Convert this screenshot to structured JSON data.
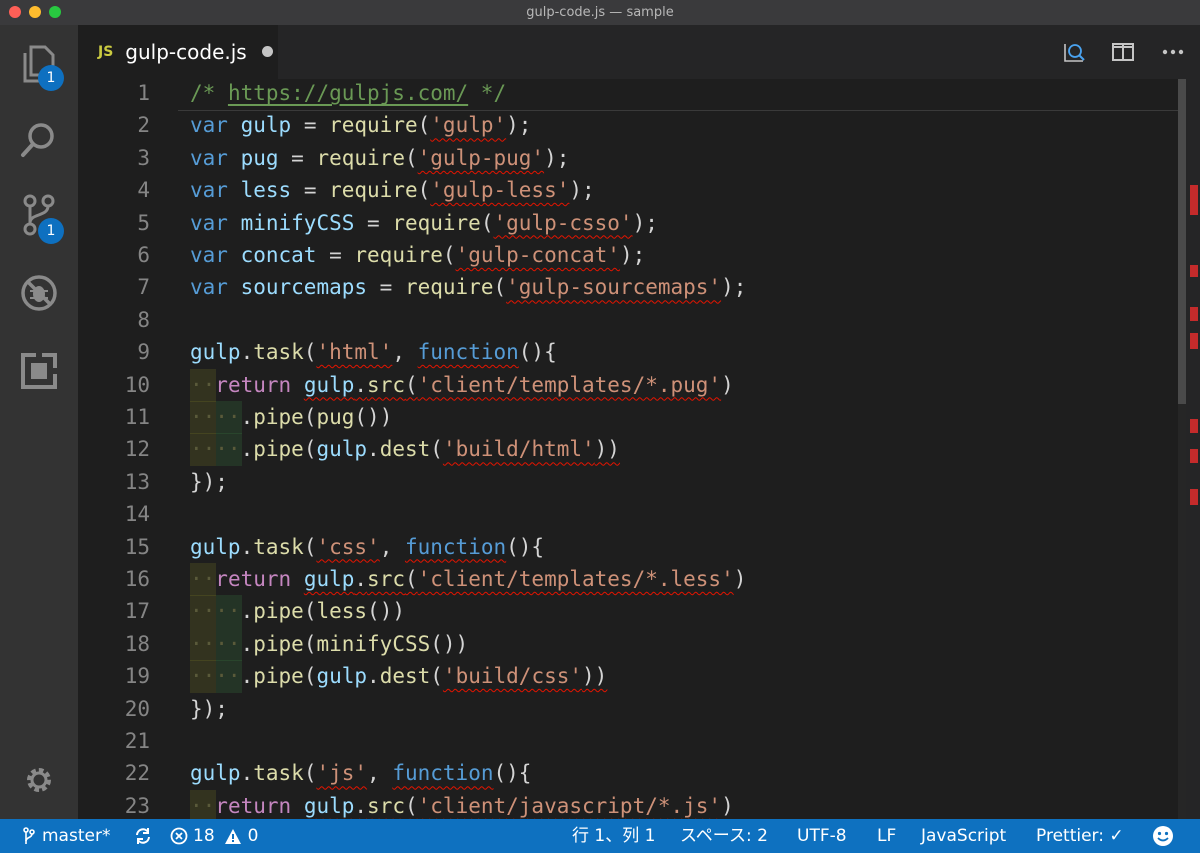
{
  "window": {
    "title": "gulp-code.js — sample"
  },
  "activity_bar": {
    "explorer_badge": "1",
    "scm_badge": "1"
  },
  "tab": {
    "lang": "JS",
    "filename": "gulp-code.js"
  },
  "editor": {
    "lines": [
      {
        "n": "1",
        "tokens": [
          {
            "t": "/* ",
            "c": "#6a9955"
          },
          {
            "t": "https://gulpjs.com/",
            "c": "#6a9955",
            "u": "link"
          },
          {
            "t": " */",
            "c": "#6a9955"
          }
        ]
      },
      {
        "n": "2",
        "tokens": [
          {
            "t": "var",
            "c": "#569cd6"
          },
          {
            "t": " "
          },
          {
            "t": "gulp",
            "c": "#9cdcfe"
          },
          {
            "t": " = "
          },
          {
            "t": "require",
            "c": "#dcdcaa"
          },
          {
            "t": "("
          },
          {
            "t": "'gulp'",
            "c": "#ce9178",
            "u": "err"
          },
          {
            "t": ");"
          }
        ]
      },
      {
        "n": "3",
        "tokens": [
          {
            "t": "var",
            "c": "#569cd6"
          },
          {
            "t": " "
          },
          {
            "t": "pug",
            "c": "#9cdcfe"
          },
          {
            "t": " = "
          },
          {
            "t": "require",
            "c": "#dcdcaa"
          },
          {
            "t": "("
          },
          {
            "t": "'gulp-pug'",
            "c": "#ce9178",
            "u": "err"
          },
          {
            "t": ");"
          }
        ]
      },
      {
        "n": "4",
        "tokens": [
          {
            "t": "var",
            "c": "#569cd6"
          },
          {
            "t": " "
          },
          {
            "t": "less",
            "c": "#9cdcfe"
          },
          {
            "t": " = "
          },
          {
            "t": "require",
            "c": "#dcdcaa"
          },
          {
            "t": "("
          },
          {
            "t": "'gulp-less'",
            "c": "#ce9178",
            "u": "err"
          },
          {
            "t": ");"
          }
        ]
      },
      {
        "n": "5",
        "tokens": [
          {
            "t": "var",
            "c": "#569cd6"
          },
          {
            "t": " "
          },
          {
            "t": "minifyCSS",
            "c": "#9cdcfe"
          },
          {
            "t": " = "
          },
          {
            "t": "require",
            "c": "#dcdcaa"
          },
          {
            "t": "("
          },
          {
            "t": "'gulp-csso'",
            "c": "#ce9178",
            "u": "err"
          },
          {
            "t": ");"
          }
        ]
      },
      {
        "n": "6",
        "tokens": [
          {
            "t": "var",
            "c": "#569cd6"
          },
          {
            "t": " "
          },
          {
            "t": "concat",
            "c": "#9cdcfe"
          },
          {
            "t": " = "
          },
          {
            "t": "require",
            "c": "#dcdcaa"
          },
          {
            "t": "("
          },
          {
            "t": "'gulp-concat'",
            "c": "#ce9178",
            "u": "err"
          },
          {
            "t": ");"
          }
        ]
      },
      {
        "n": "7",
        "tokens": [
          {
            "t": "var",
            "c": "#569cd6"
          },
          {
            "t": " "
          },
          {
            "t": "sourcemaps",
            "c": "#9cdcfe"
          },
          {
            "t": " = "
          },
          {
            "t": "require",
            "c": "#dcdcaa"
          },
          {
            "t": "("
          },
          {
            "t": "'gulp-sourcemaps'",
            "c": "#ce9178",
            "u": "err"
          },
          {
            "t": ");"
          }
        ]
      },
      {
        "n": "8",
        "tokens": []
      },
      {
        "n": "9",
        "tokens": [
          {
            "t": "gulp",
            "c": "#9cdcfe"
          },
          {
            "t": "."
          },
          {
            "t": "task",
            "c": "#dcdcaa"
          },
          {
            "t": "("
          },
          {
            "t": "'html'",
            "c": "#ce9178",
            "u": "err"
          },
          {
            "t": ", "
          },
          {
            "t": "function",
            "c": "#569cd6",
            "u": "err"
          },
          {
            "t": "(){"
          }
        ]
      },
      {
        "n": "10",
        "g": 1,
        "tokens": [
          {
            "t": "··",
            "c": "#5a5a3a"
          },
          {
            "t": "return",
            "c": "#c586c0"
          },
          {
            "t": " "
          },
          {
            "t": "gulp",
            "c": "#9cdcfe",
            "u": "err"
          },
          {
            "t": ".",
            "u": "err"
          },
          {
            "t": "src",
            "c": "#dcdcaa",
            "u": "err"
          },
          {
            "t": "(",
            "u": "err"
          },
          {
            "t": "'client/templates/*.pug'",
            "c": "#ce9178",
            "u": "err"
          },
          {
            "t": ")"
          }
        ]
      },
      {
        "n": "11",
        "g": 2,
        "tokens": [
          {
            "t": "····",
            "c": "#5a5a3a"
          },
          {
            "t": "."
          },
          {
            "t": "pipe",
            "c": "#dcdcaa"
          },
          {
            "t": "("
          },
          {
            "t": "pug",
            "c": "#dcdcaa"
          },
          {
            "t": "())"
          }
        ]
      },
      {
        "n": "12",
        "g": 2,
        "tokens": [
          {
            "t": "····",
            "c": "#5a5a3a"
          },
          {
            "t": "."
          },
          {
            "t": "pipe",
            "c": "#dcdcaa"
          },
          {
            "t": "("
          },
          {
            "t": "gulp",
            "c": "#9cdcfe"
          },
          {
            "t": "."
          },
          {
            "t": "dest",
            "c": "#dcdcaa"
          },
          {
            "t": "("
          },
          {
            "t": "'build/html'",
            "c": "#ce9178",
            "u": "err"
          },
          {
            "t": "))",
            "u": "err"
          }
        ]
      },
      {
        "n": "13",
        "tokens": [
          {
            "t": "});"
          }
        ]
      },
      {
        "n": "14",
        "tokens": []
      },
      {
        "n": "15",
        "tokens": [
          {
            "t": "gulp",
            "c": "#9cdcfe"
          },
          {
            "t": "."
          },
          {
            "t": "task",
            "c": "#dcdcaa"
          },
          {
            "t": "("
          },
          {
            "t": "'css'",
            "c": "#ce9178",
            "u": "err"
          },
          {
            "t": ", "
          },
          {
            "t": "function",
            "c": "#569cd6",
            "u": "err"
          },
          {
            "t": "(){"
          }
        ]
      },
      {
        "n": "16",
        "g": 1,
        "tokens": [
          {
            "t": "··",
            "c": "#5a5a3a"
          },
          {
            "t": "return",
            "c": "#c586c0"
          },
          {
            "t": " "
          },
          {
            "t": "gulp",
            "c": "#9cdcfe",
            "u": "err"
          },
          {
            "t": ".",
            "u": "err"
          },
          {
            "t": "src",
            "c": "#dcdcaa",
            "u": "err"
          },
          {
            "t": "(",
            "u": "err"
          },
          {
            "t": "'client/templates/*.less'",
            "c": "#ce9178",
            "u": "err"
          },
          {
            "t": ")"
          }
        ]
      },
      {
        "n": "17",
        "g": 2,
        "tokens": [
          {
            "t": "····",
            "c": "#5a5a3a"
          },
          {
            "t": "."
          },
          {
            "t": "pipe",
            "c": "#dcdcaa"
          },
          {
            "t": "("
          },
          {
            "t": "less",
            "c": "#dcdcaa"
          },
          {
            "t": "())"
          }
        ]
      },
      {
        "n": "18",
        "g": 2,
        "tokens": [
          {
            "t": "····",
            "c": "#5a5a3a"
          },
          {
            "t": "."
          },
          {
            "t": "pipe",
            "c": "#dcdcaa"
          },
          {
            "t": "("
          },
          {
            "t": "minifyCSS",
            "c": "#dcdcaa"
          },
          {
            "t": "())"
          }
        ]
      },
      {
        "n": "19",
        "g": 2,
        "tokens": [
          {
            "t": "····",
            "c": "#5a5a3a"
          },
          {
            "t": "."
          },
          {
            "t": "pipe",
            "c": "#dcdcaa"
          },
          {
            "t": "("
          },
          {
            "t": "gulp",
            "c": "#9cdcfe"
          },
          {
            "t": "."
          },
          {
            "t": "dest",
            "c": "#dcdcaa"
          },
          {
            "t": "("
          },
          {
            "t": "'build/css'",
            "c": "#ce9178",
            "u": "err"
          },
          {
            "t": "))",
            "u": "err"
          }
        ]
      },
      {
        "n": "20",
        "tokens": [
          {
            "t": "});"
          }
        ]
      },
      {
        "n": "21",
        "tokens": []
      },
      {
        "n": "22",
        "tokens": [
          {
            "t": "gulp",
            "c": "#9cdcfe"
          },
          {
            "t": "."
          },
          {
            "t": "task",
            "c": "#dcdcaa"
          },
          {
            "t": "("
          },
          {
            "t": "'js'",
            "c": "#ce9178",
            "u": "err"
          },
          {
            "t": ", "
          },
          {
            "t": "function",
            "c": "#569cd6",
            "u": "err"
          },
          {
            "t": "(){"
          }
        ]
      },
      {
        "n": "23",
        "g": 1,
        "tokens": [
          {
            "t": "··",
            "c": "#5a5a3a"
          },
          {
            "t": "return",
            "c": "#c586c0"
          },
          {
            "t": " "
          },
          {
            "t": "gulp",
            "c": "#9cdcfe",
            "u": "err"
          },
          {
            "t": ".",
            "u": "err"
          },
          {
            "t": "src",
            "c": "#dcdcaa",
            "u": "err"
          },
          {
            "t": "(",
            "u": "err"
          },
          {
            "t": "'client/javascript/*.js'",
            "c": "#ce9178",
            "u": "err"
          },
          {
            "t": ")"
          }
        ]
      }
    ]
  },
  "statusbar": {
    "branch": "master*",
    "errors": "18",
    "warnings": "0",
    "position": "行 1、列 1",
    "indent": "スペース: 2",
    "encoding": "UTF-8",
    "eol": "LF",
    "language": "JavaScript",
    "formatter": "Prettier: ✓"
  }
}
